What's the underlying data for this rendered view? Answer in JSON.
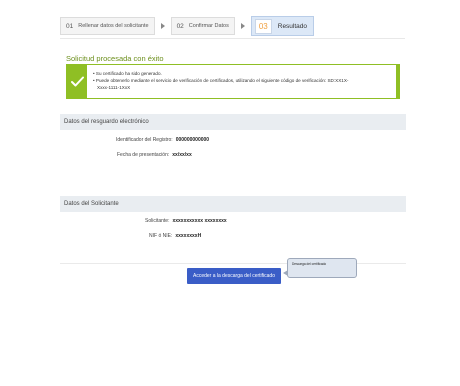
{
  "steps": [
    {
      "num": "01",
      "label": "Rellenar datos del solicitante"
    },
    {
      "num": "02",
      "label": "Confirmar Datos"
    },
    {
      "num": "03",
      "label": "Resultado"
    }
  ],
  "success": {
    "title": "Solicitud procesada con éxito",
    "line1": "Su certificado ha sido generado.",
    "line2": "Puede obtenerlo mediante el servicio de verificación de certificados, utilizando el siguiente código de verificación: SD:XX1X-",
    "line3": "Xxxx-1111-1XxX"
  },
  "resguardo": {
    "heading": "Datos del resguardo electrónico",
    "id_label": "Identificador del Registro:",
    "id_value": "000000000000",
    "date_label": "Fecha de presentación:",
    "date_value": "xx/xx/xx"
  },
  "solicitante": {
    "heading": "Datos del Solicitante",
    "name_label": "Solicitante:",
    "name_value": "xxxxxxxxxxx xxxxxxxx",
    "nif_label": "NIF ó NIE:",
    "nif_value": "xxxxxxxxH"
  },
  "actions": {
    "download_label": "Acceder a la descarga del certificado",
    "tooltip_text": "Descarga del certificado"
  }
}
